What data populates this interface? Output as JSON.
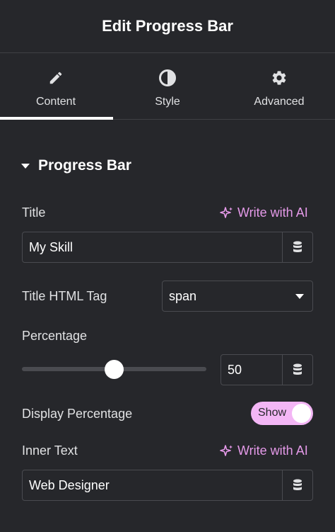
{
  "header": {
    "title": "Edit Progress Bar"
  },
  "tabs": [
    {
      "label": "Content",
      "icon": "pencil-icon",
      "active": true
    },
    {
      "label": "Style",
      "icon": "half-circle-icon",
      "active": false
    },
    {
      "label": "Advanced",
      "icon": "gear-icon",
      "active": false
    }
  ],
  "section": {
    "title": "Progress Bar"
  },
  "fields": {
    "title": {
      "label": "Title",
      "ai_label": "Write with AI",
      "value": "My Skill"
    },
    "title_tag": {
      "label": "Title HTML Tag",
      "value": "span"
    },
    "percentage": {
      "label": "Percentage",
      "value": "50",
      "slider_fraction": 0.5
    },
    "display_percentage": {
      "label": "Display Percentage",
      "toggle_label": "Show",
      "on": true
    },
    "inner_text": {
      "label": "Inner Text",
      "ai_label": "Write with AI",
      "value": "Web Designer"
    }
  },
  "colors": {
    "background": "#26272b",
    "accent_ai": "#e59ae9",
    "toggle_on": "#f3b6f5"
  }
}
